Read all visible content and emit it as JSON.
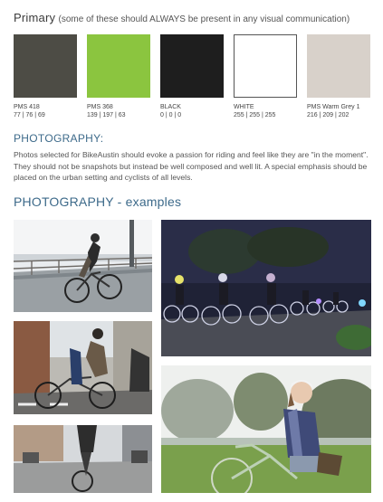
{
  "primary": {
    "title": "Primary",
    "subtitle": "(some of these should ALWAYS be present in any visual communication)",
    "swatches": [
      {
        "name": "PMS 418",
        "rgb": "77 | 76 | 69",
        "color": "#4d4c45"
      },
      {
        "name": "PMS 368",
        "rgb": "139 | 197 | 63",
        "color": "#8bc53f"
      },
      {
        "name": "BLACK",
        "rgb": "0 | 0 | 0",
        "color": "#1e1e1e"
      },
      {
        "name": "WHITE",
        "rgb": "255 | 255 | 255",
        "color": "#ffffff"
      },
      {
        "name": "PMS Warm Grey 1",
        "rgb": "216 | 209 | 202",
        "color": "#d8d1ca"
      }
    ]
  },
  "photography": {
    "title": "PHOTOGRAPHY:",
    "body": "Photos selected for BikeAustin should evoke a passion for riding and feel like they are \"in the moment\". They should not be snapshots but instead be well composed and well lit. A special emphasis should be placed on the urban setting and cyclists of all levels."
  },
  "examples": {
    "title": "PHOTOGRAPHY - examples"
  }
}
